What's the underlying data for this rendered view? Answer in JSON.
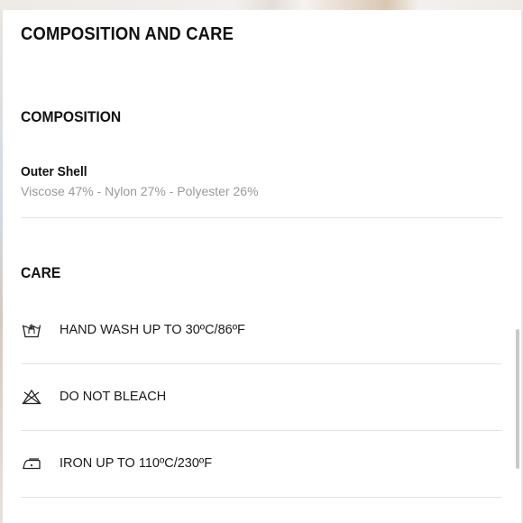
{
  "header": {
    "title": "COMPOSITION AND CARE"
  },
  "composition": {
    "heading": "COMPOSITION",
    "parts": [
      {
        "name": "Outer Shell",
        "detail": "Viscose 47% - Nylon 27% - Polyester 26%"
      }
    ]
  },
  "care": {
    "heading": "CARE",
    "items": [
      {
        "icon": "hand-wash-icon",
        "label": "HAND WASH UP TO 30ºC/86ºF"
      },
      {
        "icon": "do-not-bleach-icon",
        "label": "DO NOT BLEACH"
      },
      {
        "icon": "iron-icon",
        "label": "IRON UP TO 110ºC/230ºF"
      }
    ]
  },
  "colors": {
    "text": "#111111",
    "muted_text": "#9a9a9a",
    "divider": "#e4e4e4",
    "scrollbar": "#c9c9c9"
  }
}
